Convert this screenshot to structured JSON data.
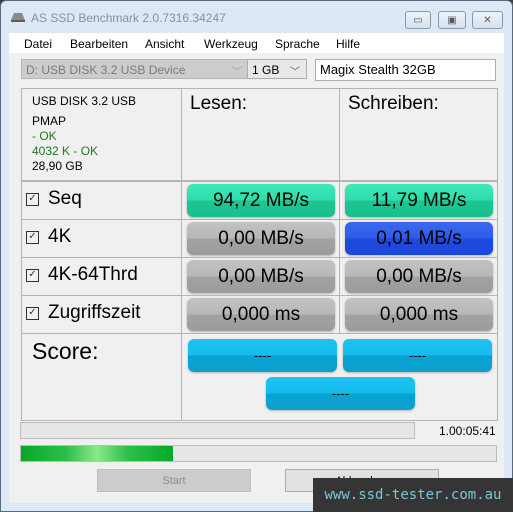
{
  "window": {
    "title": "AS SSD Benchmark 2.0.7316.34247",
    "controls": {
      "minimize": "▭",
      "maximize": "▣",
      "close": "✕"
    }
  },
  "menu": [
    "Datei",
    "Bearbeiten",
    "Ansicht",
    "Werkzeug",
    "Sprache",
    "Hilfe"
  ],
  "toolbar": {
    "drive": "D: USB DISK 3.2 USB Device",
    "size": "1 GB",
    "name": "Magix Stealth 32GB"
  },
  "device_info": {
    "model": "USB DISK 3.2 USB",
    "driver": "PMAP",
    "driver_status": " - OK",
    "alignment": "4032 K - OK",
    "capacity": "28,90 GB"
  },
  "columns": {
    "read": "Lesen:",
    "write": "Schreiben:"
  },
  "tests": [
    {
      "label": "Seq",
      "checked": true,
      "read": "94,72 MB/s",
      "write": "11,79 MB/s",
      "read_color": "green",
      "write_color": "green"
    },
    {
      "label": "4K",
      "checked": true,
      "read": "0,00 MB/s",
      "write": "0,01 MB/s",
      "read_color": "gray",
      "write_color": "blue"
    },
    {
      "label": "4K-64Thrd",
      "checked": true,
      "read": "0,00 MB/s",
      "write": "0,00 MB/s",
      "read_color": "gray",
      "write_color": "gray"
    },
    {
      "label": "Zugriffszeit",
      "checked": true,
      "read": "0,000 ms",
      "write": "0,000 ms",
      "read_color": "gray",
      "write_color": "gray"
    }
  ],
  "score": {
    "label": "Score:",
    "read": "----",
    "write": "----",
    "total": "----"
  },
  "status": {
    "elapsed": "1.00:05:41",
    "progress_top": 0,
    "progress_bottom": 0.32
  },
  "buttons": {
    "start": "Start",
    "abort": "Abbrechen"
  },
  "watermark": "www.ssd-tester.com.au",
  "colors": {
    "green": "#2fdcad",
    "gray": "#b2b2b2",
    "blue": "#2e5cea",
    "cyan": "#15bbec",
    "progress": "#06a82a"
  }
}
